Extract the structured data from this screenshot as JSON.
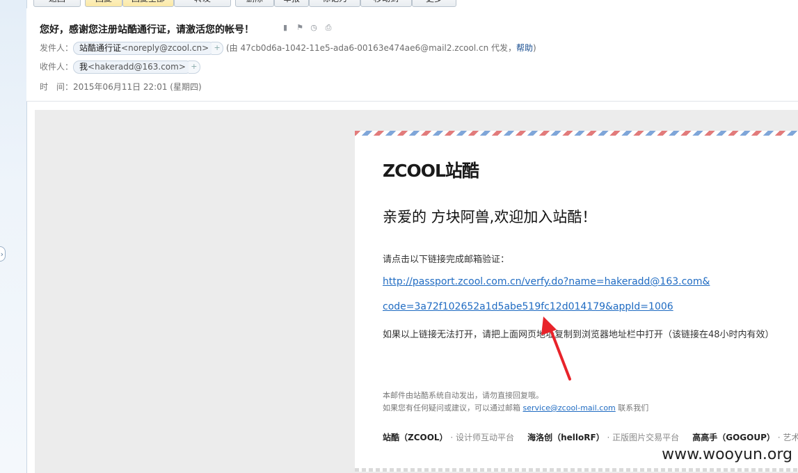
{
  "toolbar": {
    "buttons": [
      "返回",
      "回复",
      "回复全部",
      "转发",
      "删除",
      "举报",
      "标记为",
      "移动到",
      "更多"
    ]
  },
  "header": {
    "subject": "您好，感谢您注册站酷通行证，请激活您的帐号！",
    "from_label": "发件人：",
    "from_name": "站酷通行证",
    "from_addr": "<noreply@zcool.cn>",
    "from_proxy": "(由 47cb0d6a-1042-11e5-ada6-00163e474ae6@mail2.zcool.cn 代发，",
    "from_help": "帮助",
    "from_close": ")",
    "to_label": "收件人：",
    "to_name": "我",
    "to_addr": "<hakeradd@163.com>",
    "time_label": "时　间：",
    "time_value": "2015年06月11日 22:01 (星期四)"
  },
  "email": {
    "logo_text": "ZCOOL站酷",
    "greeting": "亲爱的 方块阿兽,欢迎加入站酷！",
    "instruction": "请点击以下链接完成邮箱验证：",
    "link_line1": "http://passport.zcool.com.cn/verfy.do?name=hakeradd@163.com&",
    "link_line2": "code=3a72f102652a1d5abe519fc12d014179&appId=1006",
    "fallback": "如果以上链接无法打开，请把上面网页地址复制到浏览器地址栏中打开（该链接在48小时内有效）",
    "note1": "本邮件由站酷系统自动发出，请勿直接回复哦。",
    "note2_prefix": "如果您有任何疑问或建议，可以通过邮箱 ",
    "note2_email": "service@zcool-mail.com",
    "note2_suffix": " 联系我们",
    "footer": [
      {
        "name": "站酷（ZCOOL）",
        "desc": "· 设计师互动平台"
      },
      {
        "name": "海洛创（helloRF）",
        "desc": "· 正版图片交易平台"
      },
      {
        "name": "高高手（GOGOUP）",
        "desc": "· 艺术在"
      }
    ]
  },
  "watermark": "www.wooyun.org"
}
